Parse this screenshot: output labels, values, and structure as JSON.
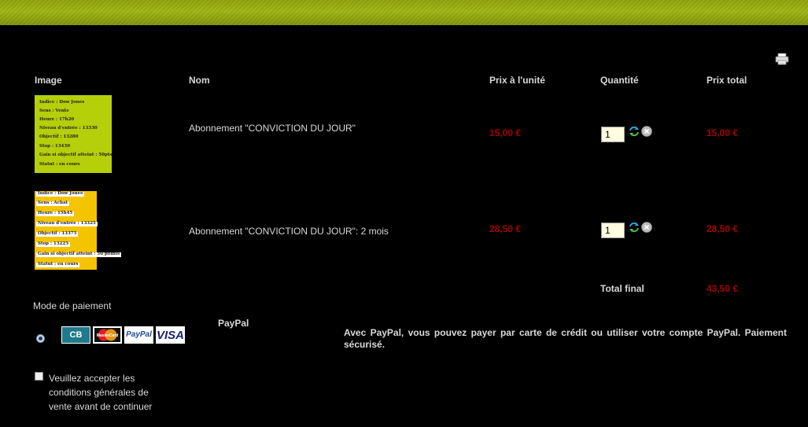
{
  "columns": {
    "image": "Image",
    "name": "Nom",
    "unit_price": "Prix à l'unité",
    "quantity": "Quantité",
    "total_price": "Prix total"
  },
  "items": [
    {
      "name": "Abonnement \"CONVICTION DU JOUR\"",
      "unit_price": "15,00 €",
      "quantity": "1",
      "total_price": "15,00 €",
      "thumb_lines": [
        "Indice : Dow Jones",
        "Sens : Vente",
        "Heure : 17h20",
        "Niveau d'entrée : 13330",
        "Objectif : 13280",
        "Stop : 13430",
        "Gain si objectif atteint : 50pts",
        "Statut : en cours"
      ]
    },
    {
      "name": "Abonnement \"CONVICTION DU JOUR\": 2 mois",
      "unit_price": "28,50 €",
      "quantity": "1",
      "total_price": "28,50 €",
      "thumb_lines": [
        "Indice : Dow Jones",
        "Sens : Achat",
        "Heure : 15h45",
        "Niveau d'entrée : 13325",
        "Objectif : 13375",
        "Stop : 13225",
        "Gain si objectif atteint : 50 points",
        "Statut : en cours"
      ]
    }
  ],
  "total": {
    "label": "Total final",
    "value": "43,50 €"
  },
  "payment": {
    "title": "Mode de paiement",
    "method_name": "PayPal",
    "cards": [
      "CB",
      "MasterCard",
      "PayPal",
      "VISA"
    ],
    "description": "Avec PayPal, vous pouvez payer par carte de crédit ou utiliser votre compte PayPal. Paiement sécurisé."
  },
  "terms": {
    "label": "Veuillez accepter les conditions générales de vente avant de continuer"
  },
  "colors": {
    "header_bar": "#9db413",
    "price": "#a80000",
    "background": "#000000"
  },
  "icons": [
    "print-icon",
    "refresh-icon",
    "delete-icon"
  ]
}
